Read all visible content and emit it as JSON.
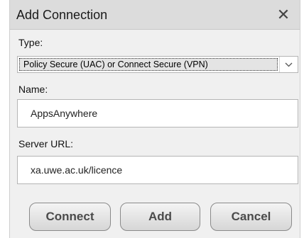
{
  "dialog": {
    "title": "Add Connection",
    "close_glyph": "✕",
    "type_label": "Type:",
    "type_value": "Policy Secure (UAC) or Connect Secure (VPN)",
    "name_label": "Name:",
    "name_value": "AppsAnywhere",
    "url_label": "Server URL:",
    "url_value": "xa.uwe.ac.uk/licence",
    "buttons": {
      "connect": "Connect",
      "add": "Add",
      "cancel": "Cancel"
    }
  },
  "icons": {
    "close": "close-icon",
    "dropdown": "chevron-down-icon"
  }
}
